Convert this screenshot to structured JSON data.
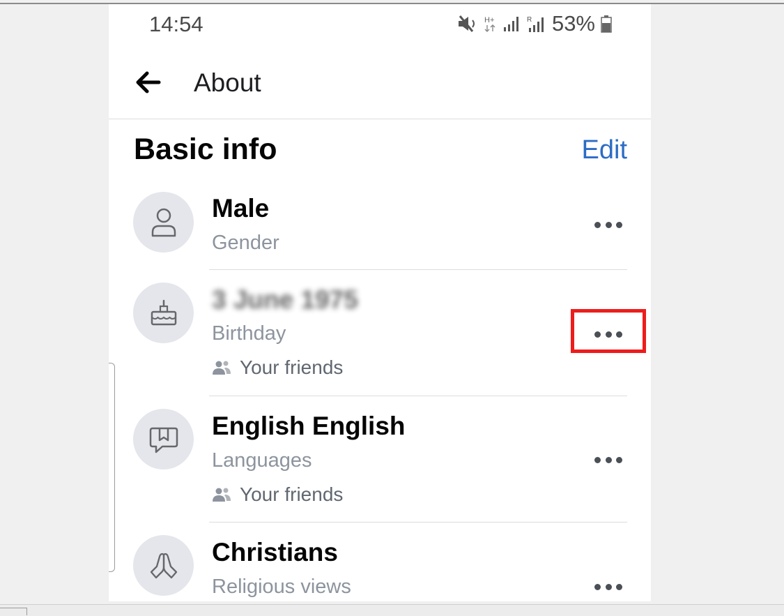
{
  "status_bar": {
    "time": "14:54",
    "network_label": "H+",
    "roaming_label": "R",
    "battery_percent": "53%"
  },
  "header": {
    "back_icon": "arrow-left-icon",
    "title": "About"
  },
  "section": {
    "title": "Basic info",
    "edit_label": "Edit"
  },
  "rows": [
    {
      "icon": "person-icon",
      "value": "Male",
      "label": "Gender",
      "audience": null
    },
    {
      "icon": "birthday-cake-icon",
      "value": "3 June 1975",
      "value_blurred": true,
      "label": "Birthday",
      "audience": "Your friends"
    },
    {
      "icon": "speech-bubble-icon",
      "value": "English English",
      "label": "Languages",
      "audience": "Your friends"
    },
    {
      "icon": "praying-hands-icon",
      "value": "Christians",
      "label": "Religious views",
      "audience": null
    }
  ],
  "colors": {
    "accent": "#2c6cc5",
    "highlight_box": "#ee1c1c",
    "icon_circle": "#e4e6eb"
  }
}
